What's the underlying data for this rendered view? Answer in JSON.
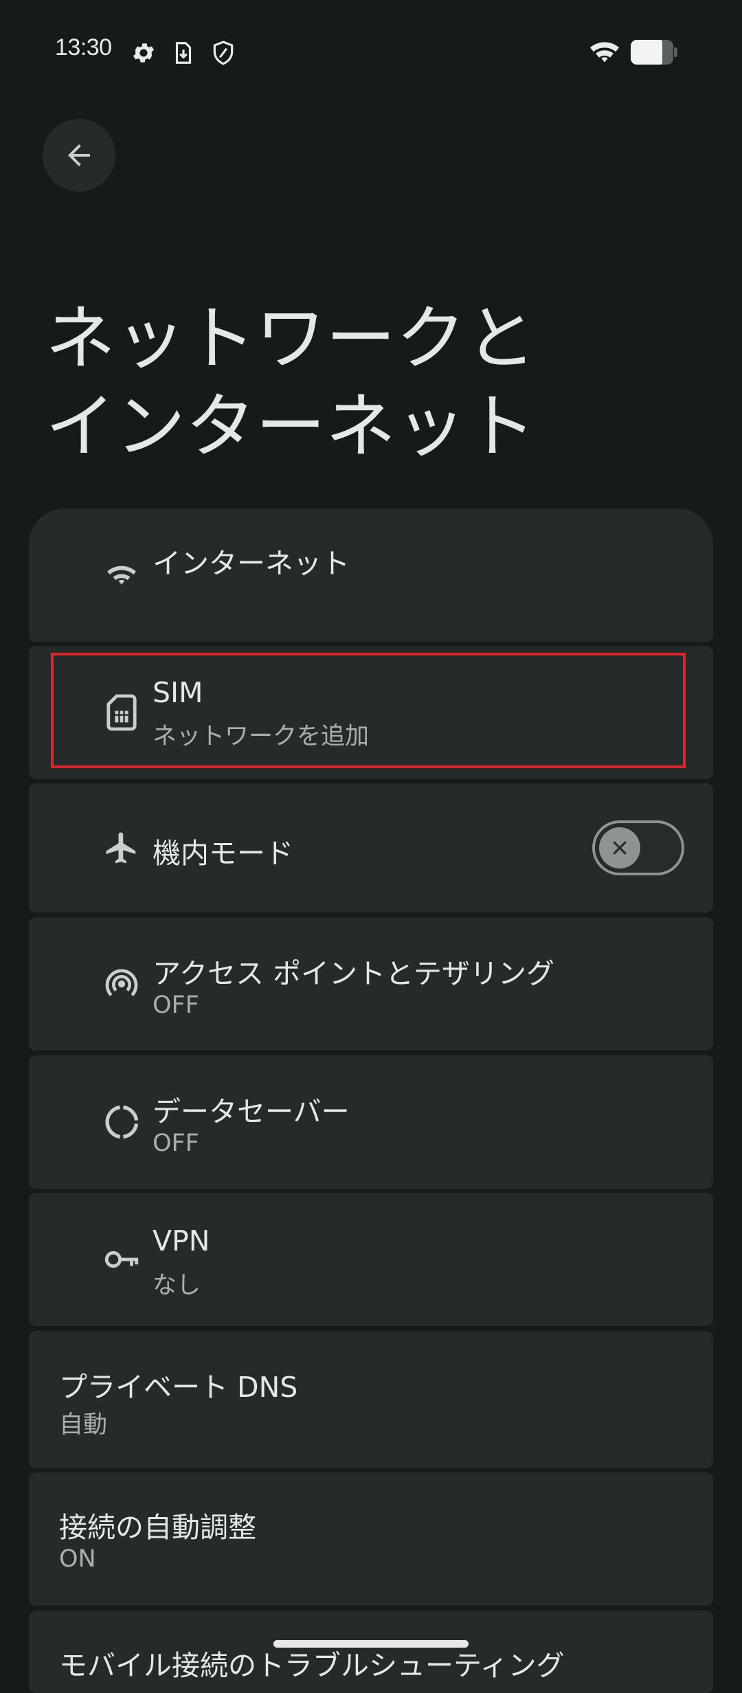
{
  "status_bar": {
    "time": "13:30",
    "icons": [
      "settings-icon",
      "download-icon",
      "shield-icon",
      "wifi-icon",
      "battery-icon"
    ]
  },
  "header": {
    "title_line1": "ネットワークと",
    "title_line2": "インターネット"
  },
  "items": [
    {
      "icon": "wifi-icon",
      "title": "インターネット",
      "subtitle": ""
    },
    {
      "icon": "sim-card-icon",
      "title": "SIM",
      "subtitle": "ネットワークを追加"
    },
    {
      "icon": "airplane-icon",
      "title": "機内モード",
      "toggle": "off"
    },
    {
      "icon": "hotspot-icon",
      "title": "アクセス ポイントとテザリング",
      "subtitle": "OFF"
    },
    {
      "icon": "data-saver-icon",
      "title": "データセーバー",
      "subtitle": "OFF"
    },
    {
      "icon": "vpn-key-icon",
      "title": "VPN",
      "subtitle": "なし"
    },
    {
      "title": "プライベート DNS",
      "subtitle": "自動"
    },
    {
      "title": "接続の自動調整",
      "subtitle": "ON"
    },
    {
      "title": "モバイル接続のトラブルシューティング"
    }
  ],
  "colors": {
    "background": "#161b1a",
    "card": "#252b2a",
    "highlight": "#d9272e",
    "text_primary": "#e4e9e6",
    "text_secondary": "#a8b0ad"
  }
}
